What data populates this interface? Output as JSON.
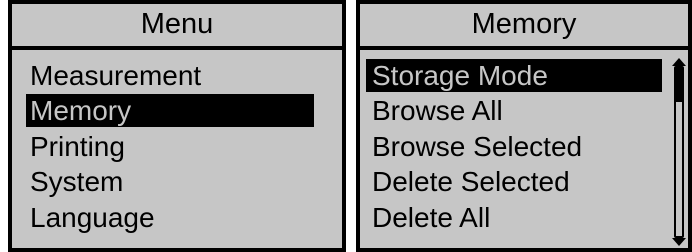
{
  "colors": {
    "screen_bg": "#c6c6c6",
    "foreground": "#000000"
  },
  "menu": {
    "title": "Menu",
    "items": [
      {
        "label": "Measurement",
        "selected": false
      },
      {
        "label": "Memory",
        "selected": true
      },
      {
        "label": "Printing",
        "selected": false
      },
      {
        "label": "System",
        "selected": false
      },
      {
        "label": "Language",
        "selected": false
      }
    ]
  },
  "memory": {
    "title": "Memory",
    "items": [
      {
        "label": "Storage Mode",
        "selected": true
      },
      {
        "label": "Browse All",
        "selected": false
      },
      {
        "label": "Browse Selected",
        "selected": false
      },
      {
        "label": "Delete Selected",
        "selected": false
      },
      {
        "label": "Delete All",
        "selected": false
      }
    ],
    "scroll_position_fraction": 0.0,
    "visible_fraction": 0.2
  }
}
